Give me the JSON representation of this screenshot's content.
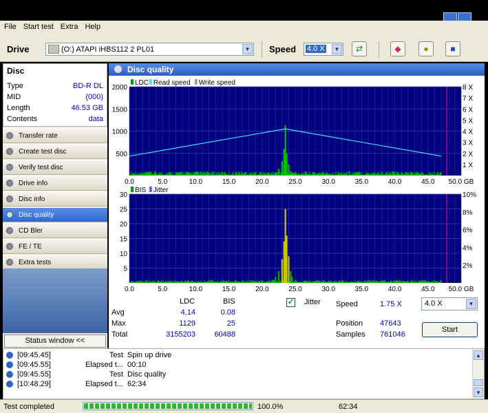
{
  "menu": [
    "File",
    "Start test",
    "Extra",
    "Help"
  ],
  "toolbar": {
    "drive_label": "Drive",
    "drive_value": "(O:)  ATAPI iHBS112  2 PL01",
    "speed_label": "Speed",
    "speed_value": "4.0 X"
  },
  "disc": {
    "title": "Disc",
    "rows": [
      {
        "label": "Type",
        "value": "BD-R DL"
      },
      {
        "label": "MID",
        "value": "(000)"
      },
      {
        "label": "Length",
        "value": "46.53 GB"
      },
      {
        "label": "Contents",
        "value": "data"
      }
    ]
  },
  "nav": [
    {
      "label": "Transfer rate",
      "active": false
    },
    {
      "label": "Create test disc",
      "active": false
    },
    {
      "label": "Verify test disc",
      "active": false
    },
    {
      "label": "Drive info",
      "active": false
    },
    {
      "label": "Disc info",
      "active": false
    },
    {
      "label": "Disc quality",
      "active": true
    },
    {
      "label": "CD Bler",
      "active": false
    },
    {
      "label": "FE / TE",
      "active": false
    },
    {
      "label": "Extra tests",
      "active": false
    }
  ],
  "status_window_label": "Status window <<",
  "main_title": "Disc quality",
  "chart_data": [
    {
      "type": "bar",
      "legend": [
        "LDC",
        "Read speed",
        "Write speed"
      ],
      "legend_colors": [
        "#00a000",
        "#40e0ff",
        "#a0a0a0"
      ],
      "x_ticks": [
        "0.0",
        "5.0",
        "10.0",
        "15.0",
        "20.0",
        "25.0",
        "30.0",
        "35.0",
        "40.0",
        "45.0",
        "50.0 GB"
      ],
      "y_ticks": [
        "2000",
        "1500",
        "1000",
        "500"
      ],
      "y2_ticks": [
        "8 X",
        "7 X",
        "6 X",
        "5 X",
        "4 X",
        "3 X",
        "2 X",
        "1 X"
      ],
      "xlim": [
        0,
        50
      ],
      "ylim": [
        0,
        2000
      ],
      "y2lim": [
        0,
        8
      ],
      "read_speed": {
        "x": [
          0,
          23.5,
          47
        ],
        "y": [
          1.75,
          4.2,
          1.75
        ]
      },
      "spike": {
        "x": [
          21.5,
          22,
          22.5,
          23,
          23.3,
          23.5,
          23.7,
          24,
          24.3,
          24.5,
          25
        ],
        "y": [
          20,
          60,
          150,
          320,
          600,
          1129,
          500,
          250,
          100,
          40,
          15
        ]
      }
    },
    {
      "type": "bar",
      "legend": [
        "BIS",
        "Jitter"
      ],
      "legend_colors": [
        "#00a000",
        "#6060ff"
      ],
      "x_ticks": [
        "0.0",
        "5.0",
        "10.0",
        "15.0",
        "20.0",
        "25.0",
        "30.0",
        "35.0",
        "40.0",
        "45.0",
        "50.0 GB"
      ],
      "y_ticks": [
        "30",
        "25",
        "20",
        "15",
        "10",
        "5"
      ],
      "y2_ticks": [
        "10%",
        "8%",
        "6%",
        "4%",
        "2%"
      ],
      "xlim": [
        0,
        50
      ],
      "ylim": [
        0,
        30
      ],
      "y2lim": [
        0,
        10
      ],
      "spike": {
        "x": [
          21.5,
          22,
          22.5,
          23,
          23.3,
          23.5,
          23.7,
          24,
          24.3,
          24.5,
          25
        ],
        "y": [
          1,
          2,
          4,
          8,
          14,
          25,
          16,
          9,
          4,
          2,
          1
        ]
      }
    }
  ],
  "stats": {
    "col_ldc": "LDC",
    "col_bis": "BIS",
    "avg_label": "Avg",
    "avg_ldc": "4.14",
    "avg_bis": "0.08",
    "max_label": "Max",
    "max_ldc": "1129",
    "max_bis": "25",
    "total_label": "Total",
    "total_ldc": "3155203",
    "total_bis": "60488",
    "jitter_label": "Jitter",
    "speed_label": "Speed",
    "speed_value": "1.75 X",
    "position_label": "Position",
    "position_value": "47643",
    "samples_label": "Samples",
    "samples_value": "761046",
    "speed_select": "4.0 X",
    "start_label": "Start"
  },
  "log": [
    {
      "time": "[09:45.45]",
      "key": "Test",
      "value": "Spin up drive"
    },
    {
      "time": "[09:45.55]",
      "key": "Elapsed t...",
      "value": "00:10"
    },
    {
      "time": "[09:45.55]",
      "key": "Test",
      "value": "Disc quality"
    },
    {
      "time": "[10:48.29]",
      "key": "Elapsed t...",
      "value": "62:34"
    }
  ],
  "statusbar": {
    "text": "Test completed",
    "progress": 1.0,
    "percent": "100.0%",
    "elapsed": "62:34"
  }
}
